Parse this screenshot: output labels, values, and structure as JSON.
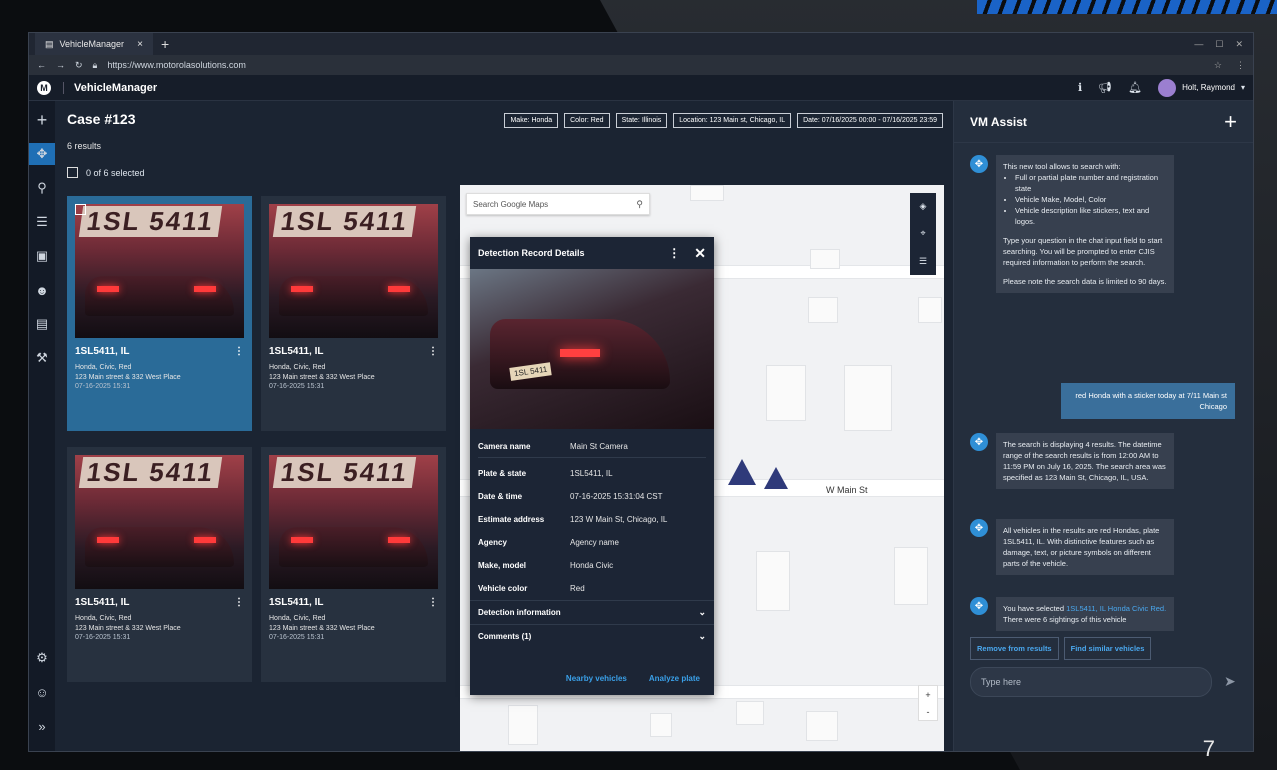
{
  "slide": {
    "number": "7"
  },
  "browser": {
    "tab_title": "VehicleManager",
    "tab_close": "×",
    "new_tab": "+",
    "url": "https://www.motorolasolutions.com",
    "window_controls": [
      "—",
      "☐",
      "✕"
    ]
  },
  "app": {
    "logo": "M",
    "name": "VehicleManager",
    "user": "Holt, Raymond"
  },
  "nav": {
    "icons": [
      "plus-icon",
      "locate-icon",
      "search-icon",
      "list-icon",
      "monitor-icon",
      "people-icon",
      "document-search-icon",
      "hammer-icon",
      "settings-icon",
      "support-icon",
      "expand-icon"
    ]
  },
  "results": {
    "case_title": "Case #123",
    "count": "6 results",
    "selected": "0 of 6 selected",
    "cards": [
      {
        "plate_img": "1SL 5411",
        "plate": "1SL5411, IL",
        "desc": "Honda, Civic, Red",
        "address": "123 Main street & 332 West Place",
        "date": "07-16-2025  15:31",
        "selected": true
      },
      {
        "plate_img": "1SL 5411",
        "plate": "1SL5411, IL",
        "desc": "Honda, Civic, Red",
        "address": "123 Main street & 332 West Place",
        "date": "07-16-2025  15:31",
        "selected": false
      },
      {
        "plate_img": "1SL 5411",
        "plate": "1SL5411, IL",
        "desc": "Honda, Civic, Red",
        "address": "123 Main street & 332 West Place",
        "date": "07-16-2025  15:31",
        "selected": false
      },
      {
        "plate_img": "1SL 5411",
        "plate": "1SL5411, IL",
        "desc": "Honda, Civic, Red",
        "address": "123 Main street & 332 West Place",
        "date": "07-16-2025  15:31",
        "selected": false
      }
    ]
  },
  "filters": [
    "Make: Honda",
    "Color: Red",
    "State: Illinois",
    "Location: 123 Main st, Chicago, IL",
    "Date: 07/16/2025 00:00 - 07/16/2025 23:59"
  ],
  "map": {
    "search_placeholder": "Search Google Maps",
    "street": "W Main St",
    "zoom_in": "+",
    "zoom_out": "-"
  },
  "detail": {
    "title": "Detection Record Details",
    "photo_plate": "1SL 5411",
    "rows": [
      {
        "k": "Camera name",
        "v": "Main St Camera"
      },
      {
        "k": "Plate & state",
        "v": "1SL5411, IL"
      },
      {
        "k": "Date & time",
        "v": "07-16-2025    15:31:04 CST"
      },
      {
        "k": "Estimate address",
        "v": "123 W Main St, Chicago, IL"
      },
      {
        "k": "Agency",
        "v": "Agency name"
      },
      {
        "k": "Make, model",
        "v": "Honda Civic"
      },
      {
        "k": "Vehicle color",
        "v": "Red"
      }
    ],
    "section1": "Detection information",
    "section2": "Comments (1)",
    "action1": "Nearby vehicles",
    "action2": "Analyze plate"
  },
  "assist": {
    "title": "VM Assist",
    "msg1_intro": "This new tool allows to search with:",
    "msg1_items": [
      "Full or partial plate number and registration state",
      "Vehicle Make, Model, Color",
      "Vehicle description like stickers,  text and logos."
    ],
    "msg1_p2": "Type your question in the chat input field to start searching. You will be prompted to enter CJIS required information to perform the search.",
    "msg1_p3": "Please note the search data is limited to 90 days.",
    "user_msg": "red Honda with a sticker today at 7/11 Main st Chicago",
    "msg2": "The search is displaying 4 results. The datetime range of the search results is from 12:00 AM to 11:59 PM on July 16, 2025. The search area was specified as 123 Main St, Chicago, IL, USA.",
    "msg3": "All vehicles in the results are red Hondas, plate 1SL5411, IL. With distinctive features such as damage, text, or picture symbols on different parts of the vehicle.",
    "msg4_pre": "You have selected ",
    "msg4_link": "1SL5411, IL Honda Civic Red.",
    "msg4_post": "There were 6 sightings of this vehicle",
    "btn_remove": "Remove from results",
    "btn_similar": "Find similar vehicles",
    "input_placeholder": "Type here"
  },
  "colors": {
    "accent": "#1f6fb5",
    "link": "#4aa8ef",
    "panel": "#1c2535"
  }
}
